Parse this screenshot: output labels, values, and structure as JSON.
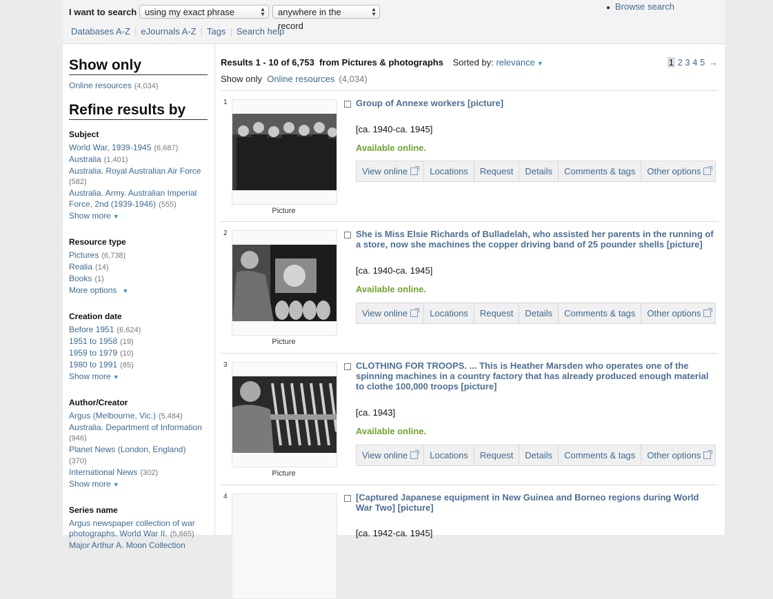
{
  "search": {
    "label": "I want to search",
    "phrase_option": "using my exact phrase",
    "scope_option": "anywhere in the record",
    "browse_link": "Browse search"
  },
  "nav": [
    "Databases A-Z",
    "eJournals A-Z",
    "Tags",
    "Search help"
  ],
  "sidebar": {
    "show_only_heading": "Show only",
    "online": {
      "label": "Online resources",
      "count": "(4,034)"
    },
    "refine_heading": "Refine results by",
    "subject": {
      "title": "Subject",
      "items": [
        {
          "label": "World War, 1939-1945",
          "count": "(6,687)"
        },
        {
          "label": "Australia",
          "count": "(1,401)"
        },
        {
          "label": "Australia. Royal Australian Air Force",
          "count": "(582)"
        },
        {
          "label": "Australia. Army. Australian Imperial Force, 2nd (1939-1946)",
          "count": "(555)"
        }
      ],
      "more": "Show more"
    },
    "resource_type": {
      "title": "Resource type",
      "items": [
        {
          "label": "Pictures",
          "count": "(6,738)"
        },
        {
          "label": "Realia",
          "count": "(14)"
        },
        {
          "label": "Books",
          "count": "(1)"
        }
      ],
      "more": "More options"
    },
    "creation_date": {
      "title": "Creation date",
      "items": [
        {
          "label": "Before 1951",
          "count": "(6,624)"
        },
        {
          "label": "1951 to 1958",
          "count": "(19)"
        },
        {
          "label": "1959 to 1979",
          "count": "(10)"
        },
        {
          "label": "1980 to 1991",
          "count": "(85)"
        }
      ],
      "more": "Show more"
    },
    "author": {
      "title": "Author/Creator",
      "items": [
        {
          "label": "Argus (Melbourne, Vic.)",
          "count": "(5,484)"
        },
        {
          "label": "Australia. Department of Information",
          "count": "(946)"
        },
        {
          "label": "Planet News (London, England)",
          "count": "(370)"
        },
        {
          "label": "International News",
          "count": "(302)"
        }
      ],
      "more": "Show more"
    },
    "series": {
      "title": "Series name",
      "items": [
        {
          "label": "Argus newspaper collection of war photographs. World War II.",
          "count": "(5,665)"
        },
        {
          "label": "Major Arthur A. Moon Collection",
          "count": ""
        }
      ]
    }
  },
  "results": {
    "range": "Results 1 - 10 of 6,753",
    "from": "from Pictures & photographs",
    "sorted_label": "Sorted by:",
    "sorted_value": "relevance",
    "pages": [
      "1",
      "2",
      "3",
      "4",
      "5"
    ],
    "next_arrow": "→",
    "show_only_label": "Show only",
    "show_only_link": "Online resources",
    "show_only_count": "(4,034)",
    "actions": [
      "View online",
      "Locations",
      "Request",
      "Details",
      "Comments & tags",
      "Other options"
    ],
    "items": [
      {
        "num": "1",
        "title": "Group of Annexe workers [picture]",
        "date": "[ca. 1940-ca. 1945]",
        "status": "Available online.",
        "type": "Picture"
      },
      {
        "num": "2",
        "title": "She is Miss Elsie Richards of Bulladelah, who assisted her parents in the running of a store, now she machines the copper driving band of 25 pounder shells [picture]",
        "date": "[ca. 1940-ca. 1945]",
        "status": "Available online.",
        "type": "Picture"
      },
      {
        "num": "3",
        "title": "CLOTHING FOR TROOPS. ... This is Heather Marsden who operates one of the spinning machines in a country factory that has already produced enough material to clothe 100,000 troops [picture]",
        "date": "[ca. 1943]",
        "status": "Available online.",
        "type": "Picture"
      },
      {
        "num": "4",
        "title": "[Captured Japanese equipment in New Guinea and Borneo regions during World War Two] [picture]",
        "date": "[ca. 1942-ca. 1945]",
        "status": "",
        "type": ""
      }
    ]
  },
  "colors": {
    "link": "#3d6a93",
    "title": "#4c6f93",
    "available": "#6ea32e",
    "accent_arrow": "#2a8fc7"
  }
}
